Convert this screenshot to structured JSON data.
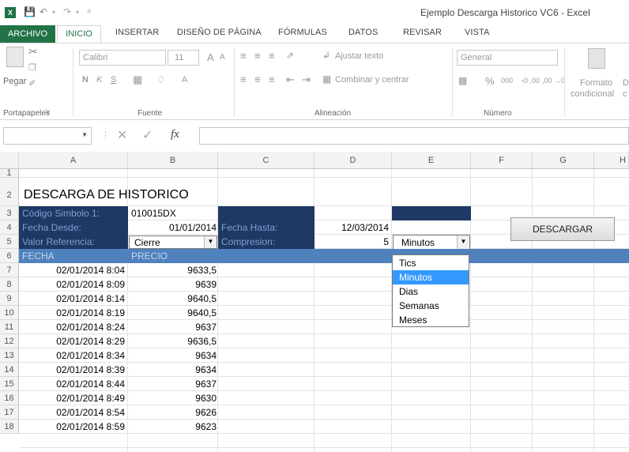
{
  "window": {
    "title": "Ejemplo Descarga Historico VC6 - Excel",
    "app_icon": "X",
    "qat": {
      "save_icon": "save-icon",
      "undo_icon": "undo-icon",
      "redo_icon": "redo-icon",
      "custom_icon": "customize-icon"
    }
  },
  "tabs": {
    "archivo": "ARCHIVO",
    "inicio": "INICIO",
    "insertar": "INSERTAR",
    "diseno": "DISEÑO DE PÁGINA",
    "formulas": "FÓRMULAS",
    "datos": "DATOS",
    "revisar": "REVISAR",
    "vista": "VISTA"
  },
  "ribbon": {
    "clipboard": {
      "paste": "Pegar",
      "group": "Portapapeles"
    },
    "font": {
      "name": "Calibri",
      "size": "11",
      "bold": "N",
      "italic": "K",
      "underline": "S",
      "grow": "A",
      "shrink": "A",
      "color": "A",
      "group": "Fuente"
    },
    "alignment": {
      "wrap": "Ajustar texto",
      "merge": "Combinar y centrar",
      "group": "Alineación"
    },
    "number": {
      "format": "General",
      "percent": "%",
      "thousands": "000",
      "inc_dec": "‹0 ,00",
      "dec_dec": ",00 →0",
      "group": "Número"
    },
    "styles": {
      "conditional_1": "Formato",
      "conditional_2": "condicional",
      "next": "D",
      "next2": "c"
    }
  },
  "formula_bar": {
    "fx": "fx",
    "cancel": "✕",
    "enter": "✓",
    "namebox": "",
    "value": ""
  },
  "columns": [
    "A",
    "B",
    "C",
    "D",
    "E",
    "F",
    "G",
    "H"
  ],
  "rows": [
    "1",
    "2",
    "3",
    "4",
    "5",
    "6",
    "7",
    "8",
    "9",
    "10",
    "11",
    "12",
    "13",
    "14",
    "15",
    "16",
    "17",
    "18"
  ],
  "sheet": {
    "title": "DESCARGA DE HISTORICO",
    "codigo_label": "Código Simbolo 1:",
    "codigo_value": "010015DX",
    "fecha_desde_label": "Fecha Desde:",
    "fecha_desde_value": "01/01/2014",
    "fecha_hasta_label": "Fecha Hasta:",
    "fecha_hasta_value": "12/03/2014",
    "valor_ref_label": "Valor Referencia:",
    "valor_ref_value": "Cierre",
    "compresion_label": "Compresion:",
    "compresion_value": "5",
    "compresion_unit": "Minutos",
    "col_fecha": "FECHA",
    "col_precio": "PRECIO",
    "download_button": "DESCARGAR",
    "data_rows": [
      {
        "fecha": "02/01/2014 8:04",
        "precio": "9633,5"
      },
      {
        "fecha": "02/01/2014 8:09",
        "precio": "9639"
      },
      {
        "fecha": "02/01/2014 8:14",
        "precio": "9640,5"
      },
      {
        "fecha": "02/01/2014 8:19",
        "precio": "9640,5"
      },
      {
        "fecha": "02/01/2014 8:24",
        "precio": "9637"
      },
      {
        "fecha": "02/01/2014 8:29",
        "precio": "9636,5"
      },
      {
        "fecha": "02/01/2014 8:34",
        "precio": "9634"
      },
      {
        "fecha": "02/01/2014 8:39",
        "precio": "9634"
      },
      {
        "fecha": "02/01/2014 8:44",
        "precio": "9637"
      },
      {
        "fecha": "02/01/2014 8:49",
        "precio": "9630"
      },
      {
        "fecha": "02/01/2014 8:54",
        "precio": "9626"
      },
      {
        "fecha": "02/01/2014 8:59",
        "precio": "9623"
      }
    ],
    "unit_options": [
      "Tics",
      "Minutos",
      "Dias",
      "Semanas",
      "Meses"
    ],
    "unit_selected": "Minutos"
  }
}
